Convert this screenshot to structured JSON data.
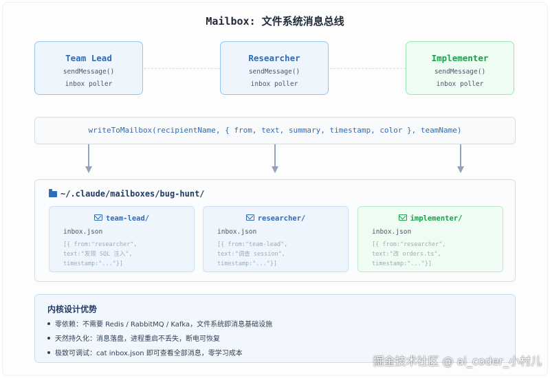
{
  "title": "Mailbox: 文件系统消息总线",
  "agents": [
    {
      "name": "Team Lead",
      "line1": "sendMessage()",
      "line2": "inbox poller",
      "style": "blue"
    },
    {
      "name": "Researcher",
      "line1": "sendMessage()",
      "line2": "inbox poller",
      "style": "blue"
    },
    {
      "name": "Implementer",
      "line1": "sendMessage()",
      "line2": "inbox poller",
      "style": "green"
    }
  ],
  "write_call": "writeToMailbox(recipientName, { from, text, summary, timestamp, color }, teamName)",
  "filesystem": {
    "path": "~/.claude/mailboxes/bug-hunt/",
    "icon": "folder-icon",
    "mailboxes": [
      {
        "dir": "team-lead/",
        "file": "inbox.json",
        "sample": "[{ from:\"researcher\",\ntext:\"发现 SQL 注入\",\ntimestamp:\"...\"}]"
      },
      {
        "dir": "researcher/",
        "file": "inbox.json",
        "sample": "[{ from:\"team-lead\",\ntext:\"调查 session\",\ntimestamp:\"...\"}]"
      },
      {
        "dir": "implementer/",
        "file": "inbox.json",
        "sample": "[{ from:\"researcher\",\ntext:\"改 orders.ts\",\ntimestamp:\"...\"}]"
      }
    ]
  },
  "advantages": {
    "title": "内核设计优势",
    "items": [
      "零依赖：不需要 Redis / RabbitMQ / Kafka，文件系统即消息基础设施",
      "天然持久化：消息落盘，进程重启不丢失，断电可恢复",
      "极致可调试：cat inbox.json 即可查看全部消息，零学习成本"
    ]
  },
  "watermark": "掘金技术社区 @ ai_coder_小村儿",
  "colors": {
    "blue_accent": "#2d6cb8",
    "green_accent": "#16a34a",
    "arrow": "#94a3b8"
  }
}
